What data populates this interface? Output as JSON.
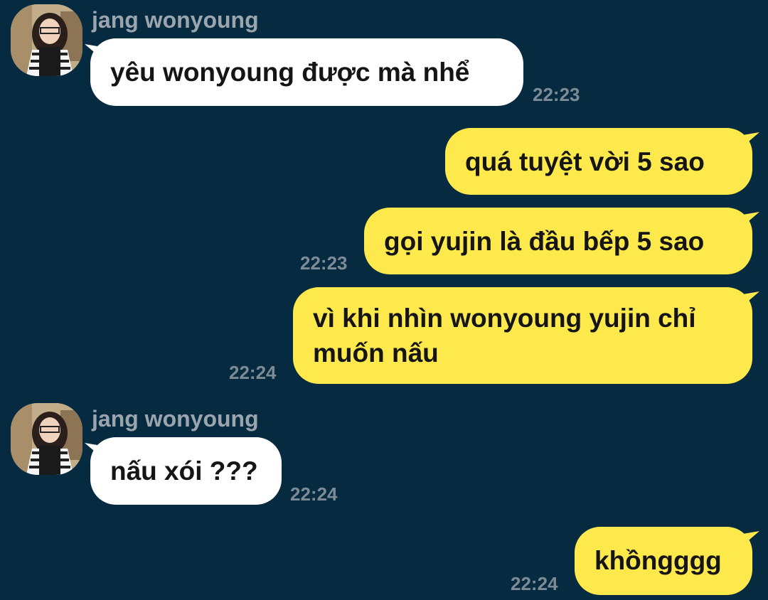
{
  "chat": {
    "messages": [
      {
        "direction": "in",
        "sender": "jang wonyoung",
        "text": "yêu wonyoung được mà nhể",
        "time": "22:23"
      },
      {
        "direction": "out",
        "text": "quá tuyệt vời 5 sao",
        "time": ""
      },
      {
        "direction": "out",
        "text": "gọi yujin là đầu bếp 5 sao",
        "time": "22:23"
      },
      {
        "direction": "out",
        "text": "vì khi nhìn wonyoung yujin chỉ muốn nấu",
        "time": "22:24"
      },
      {
        "direction": "in",
        "sender": "jang wonyoung",
        "text": "nấu xói ???",
        "time": "22:24"
      },
      {
        "direction": "out",
        "text": "khồngggg",
        "time": "22:24"
      }
    ]
  },
  "icons": {
    "avatar": "profile-photo"
  },
  "colors": {
    "background": "#062a40",
    "incoming_bubble": "#ffffff",
    "outgoing_bubble": "#fee94d",
    "sender_name": "#9aa5ae",
    "timestamp": "#7c8b96"
  }
}
